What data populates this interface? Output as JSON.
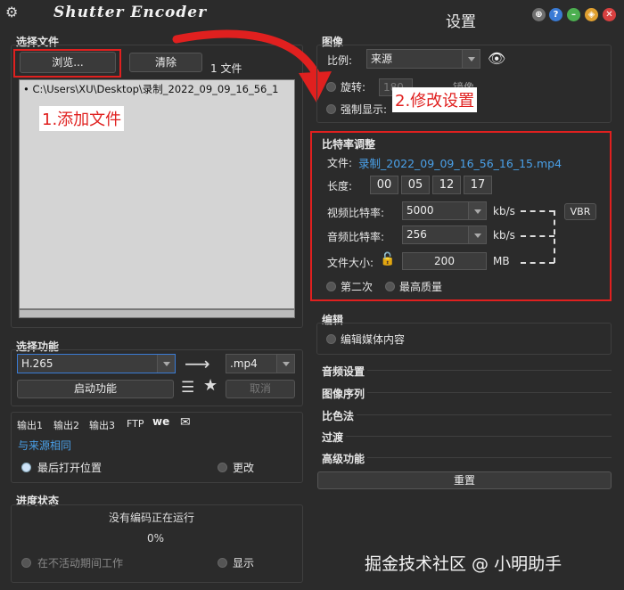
{
  "app": {
    "title": "Shutter Encoder",
    "settings_title": "设置"
  },
  "file_section": {
    "label": "选择文件",
    "browse": "浏览...",
    "clear": "清除",
    "count": "1 文件",
    "files": [
      "C:\\Users\\XU\\Desktop\\录制_2022_09_09_16_56_1"
    ]
  },
  "annotations": {
    "add_file": "1.添加文件",
    "modify_settings": "2.修改设置"
  },
  "function_section": {
    "label": "选择功能",
    "codec": "H.265",
    "container": ".mp4",
    "start": "启动功能",
    "cancel": "取消"
  },
  "output_section": {
    "tabs": [
      "输出1",
      "输出2",
      "输出3",
      "FTP"
    ],
    "same_as_source": "与来源相同",
    "open_location": "最后打开位置",
    "change": "更改"
  },
  "progress_section": {
    "label": "进度状态",
    "status": "没有编码正在运行",
    "percent": "0%",
    "idle_work": "在不活动期间工作",
    "show": "显示"
  },
  "image_section": {
    "label": "图像",
    "ratio_label": "比例:",
    "ratio_value": "来源",
    "rotate": "旋转:",
    "rotate_value": "180",
    "mirror": "镜像",
    "force_display": "强制显示:"
  },
  "bitrate_section": {
    "label": "比特率调整",
    "file_label": "文件:",
    "file_name": "录制_2022_09_09_16_56_16_15.mp4",
    "length_label": "长度:",
    "length": [
      "00",
      "05",
      "12",
      "17"
    ],
    "video_label": "视频比特率:",
    "video_value": "5000",
    "audio_label": "音频比特率:",
    "audio_value": "256",
    "unit_kbs": "kb/s",
    "vbr": "VBR",
    "size_label": "文件大小:",
    "size_value": "200",
    "unit_mb": "MB",
    "second_pass": "第二次",
    "best_quality": "最高质量"
  },
  "edit_section": {
    "label": "编辑",
    "edit_media": "编辑媒体内容"
  },
  "collapsed_sections": [
    "音频设置",
    "图像序列",
    "比色法",
    "过渡",
    "高级功能"
  ],
  "reset": "重置",
  "watermark": "掘金技术社区 @ 小明助手"
}
